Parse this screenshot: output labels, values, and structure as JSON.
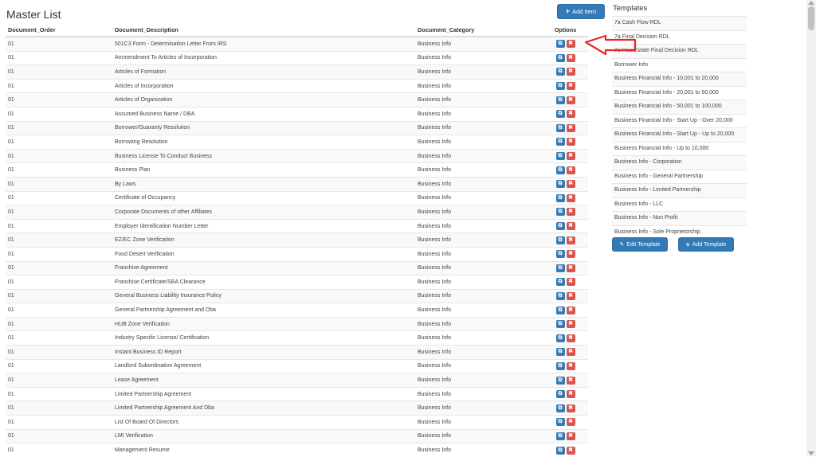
{
  "master": {
    "title": "Master List",
    "add_item_label": "Add Item",
    "columns": [
      "Document_Order",
      "Document_Description",
      "Document_Category",
      "Options"
    ],
    "rows": [
      [
        "01",
        "501C3 Form - Determination Letter From IRS",
        "Business Info"
      ],
      [
        "01",
        "Ammendment To Articles of Incorporation",
        "Business Info"
      ],
      [
        "01",
        "Articles of Formation",
        "Business Info"
      ],
      [
        "01",
        "Articles of Incorporation",
        "Business Info"
      ],
      [
        "01",
        "Articles of Organization",
        "Business Info"
      ],
      [
        "01",
        "Assumed Business Name / DBA",
        "Business Info"
      ],
      [
        "01",
        "Borrower/Guaranty Resolution",
        "Business Info"
      ],
      [
        "01",
        "Borrowing Resolution",
        "Business Info"
      ],
      [
        "01",
        "Business License To Conduct Business",
        "Business Info"
      ],
      [
        "01",
        "Business Plan",
        "Business Info"
      ],
      [
        "01",
        "By Laws",
        "Business Info"
      ],
      [
        "01",
        "Certificate of Occupancy",
        "Business Info"
      ],
      [
        "01",
        "Corporate Documents of other Affiliates",
        "Business Info"
      ],
      [
        "01",
        "Employer Identification Number Letter",
        "Business Info"
      ],
      [
        "01",
        "EZ/EC Zone Verification",
        "Business Info"
      ],
      [
        "01",
        "Food Desert Verification",
        "Business Info"
      ],
      [
        "01",
        "Franchise Agreement",
        "Business Info"
      ],
      [
        "01",
        "Franchise Certificate/SBA Clearance",
        "Business Info"
      ],
      [
        "01",
        "General Business Liability Insurance Policy",
        "Business Info"
      ],
      [
        "01",
        "General Partnership Agreement and Dba",
        "Business Info"
      ],
      [
        "01",
        "HUB Zone Verification",
        "Business Info"
      ],
      [
        "01",
        "Industry Specific License/ Certification",
        "Business Info"
      ],
      [
        "01",
        "Instant Business ID Report",
        "Business Info"
      ],
      [
        "01",
        "Landlord Subordination Agreement",
        "Business Info"
      ],
      [
        "01",
        "Lease Agreement",
        "Business Info"
      ],
      [
        "01",
        "Limited Partnership Agreement",
        "Business Info"
      ],
      [
        "01",
        "Limited Partnership Agreement And Dba",
        "Business Info"
      ],
      [
        "01",
        "List Of Board Of Directors",
        "Business Info"
      ],
      [
        "01",
        "LMI Verification",
        "Business Info"
      ],
      [
        "01",
        "Management Resume",
        "Business Info"
      ]
    ]
  },
  "templates": {
    "title": "Templates",
    "items": [
      "7a Cash Flow RDL",
      "7a Final Decision RDL",
      "7a RealEstate Final Decision RDL",
      "Borrower Info",
      "Business Financial Info - 10,001 to 20,000",
      "Business Financial Info - 20,001 to 50,000",
      "Business Financial Info - 50,001 to 100,000",
      "Business Financial Info - Start Up - Over 20,000",
      "Business Financial Info - Start Up - Up to 20,000",
      "Business Financial Info - Up to 10,000",
      "Business Info - Corporation",
      "Business Info - General Partnership",
      "Business Info - Limited Partnership",
      "Business Info - LLC",
      "Business Info - Non Profit",
      "Business Info - Sole Proprietorship"
    ],
    "edit_label": "Edit Template",
    "add_label": "Add Template"
  },
  "icons": {
    "add": "plus-icon",
    "edit": "edit-icon",
    "delete": "delete-x-icon",
    "pencil": "pencil-icon",
    "annotation": "red-arrow-annotation"
  },
  "colors": {
    "primary": "#337ab7",
    "danger": "#d9534f",
    "annotation": "#e8262a"
  }
}
